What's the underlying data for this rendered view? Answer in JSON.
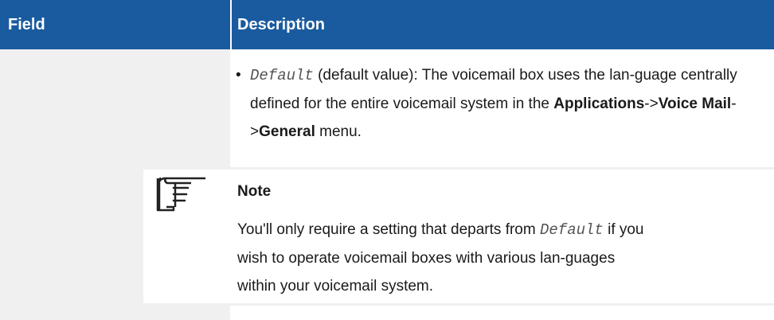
{
  "header": {
    "field_label": "Field",
    "description_label": "Description"
  },
  "bullet": {
    "code": "Default",
    "text_1": " (default value): The voicemail box uses the lan-guage centrally defined for the entire voicemail system in the ",
    "menu_1": "Applications",
    "sep_1": "->",
    "menu_2": "Voice Mail",
    "sep_2": "->",
    "menu_3": "General",
    "text_2": " menu."
  },
  "note": {
    "title": "Note",
    "text_1": "You'll only require a setting that departs from ",
    "code": "Default",
    "text_2": " if you wish to operate voicemail boxes with various lan-guages within your voicemail system."
  },
  "icons": {
    "note_icon": "pointing-hand-icon"
  },
  "colors": {
    "header_background": "#1a5b9f",
    "field_column_background": "#f0f0f0"
  }
}
